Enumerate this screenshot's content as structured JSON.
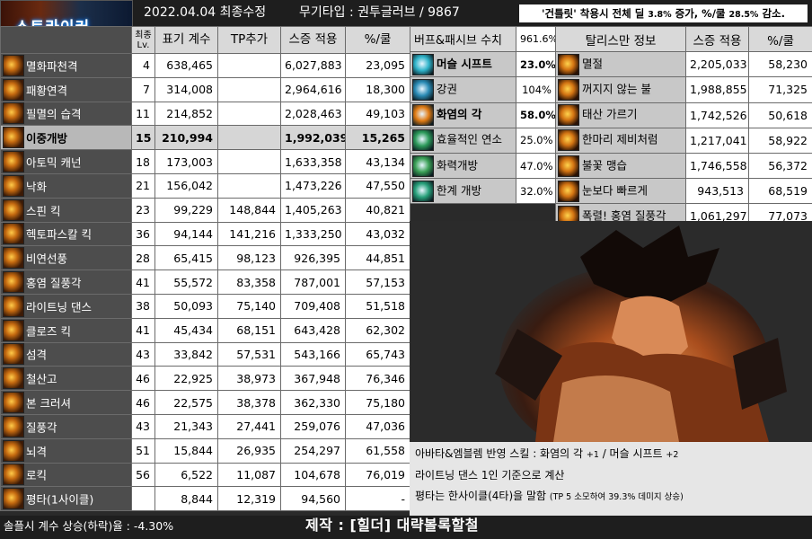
{
  "banner": {
    "logo_text": "스트라이커"
  },
  "header": {
    "date": "2022.04.04 최종수정",
    "weapon": "무기타입 : 권투글러브 / 9867"
  },
  "notice": {
    "prefix": "'건틀릿' 착용시 전체 딜 ",
    "v1": "3.8%",
    "mid": " 증가, %/쿨 ",
    "v2": "28.5%",
    "suffix": " 감소."
  },
  "skills": {
    "columns": {
      "level": "최종\nLv.",
      "coef": "표기 계수",
      "tp": "TP추가",
      "stat": "스증 적용",
      "per_cd": "%/쿨"
    },
    "rows": [
      {
        "name": "멸화파천격",
        "lv": "4",
        "coef": "638,465",
        "tp": "",
        "stat": "6,027,883",
        "per_cd": "23,095"
      },
      {
        "name": "패황연격",
        "lv": "7",
        "coef": "314,008",
        "tp": "",
        "stat": "2,964,616",
        "per_cd": "18,300"
      },
      {
        "name": "필멸의 습격",
        "lv": "11",
        "coef": "214,852",
        "tp": "",
        "stat": "2,028,463",
        "per_cd": "49,103"
      },
      {
        "name": "이중개방",
        "lv": "15",
        "coef": "210,994",
        "tp": "",
        "stat": "1,992,039",
        "per_cd": "15,265",
        "highlight": true
      },
      {
        "name": "아토믹 캐넌",
        "lv": "18",
        "coef": "173,003",
        "tp": "",
        "stat": "1,633,358",
        "per_cd": "43,134"
      },
      {
        "name": "낙화",
        "lv": "21",
        "coef": "156,042",
        "tp": "",
        "stat": "1,473,226",
        "per_cd": "47,550"
      },
      {
        "name": "스핀 킥",
        "lv": "23",
        "coef": "99,229",
        "tp": "148,844",
        "stat": "1,405,263",
        "per_cd": "40,821"
      },
      {
        "name": "헥토파스칼 킥",
        "lv": "36",
        "coef": "94,144",
        "tp": "141,216",
        "stat": "1,333,250",
        "per_cd": "43,032"
      },
      {
        "name": "비연선풍",
        "lv": "28",
        "coef": "65,415",
        "tp": "98,123",
        "stat": "926,395",
        "per_cd": "44,851"
      },
      {
        "name": "홍염 질풍각",
        "lv": "41",
        "coef": "55,572",
        "tp": "83,358",
        "stat": "787,001",
        "per_cd": "57,153"
      },
      {
        "name": "라이트닝 댄스",
        "lv": "38",
        "coef": "50,093",
        "tp": "75,140",
        "stat": "709,408",
        "per_cd": "51,518"
      },
      {
        "name": "클로즈 킥",
        "lv": "41",
        "coef": "45,434",
        "tp": "68,151",
        "stat": "643,428",
        "per_cd": "62,302"
      },
      {
        "name": "섬격",
        "lv": "43",
        "coef": "33,842",
        "tp": "57,531",
        "stat": "543,166",
        "per_cd": "65,743"
      },
      {
        "name": "철산고",
        "lv": "46",
        "coef": "22,925",
        "tp": "38,973",
        "stat": "367,948",
        "per_cd": "76,346"
      },
      {
        "name": "본 크러셔",
        "lv": "46",
        "coef": "22,575",
        "tp": "38,378",
        "stat": "362,330",
        "per_cd": "75,180"
      },
      {
        "name": "질풍각",
        "lv": "43",
        "coef": "21,343",
        "tp": "27,441",
        "stat": "259,076",
        "per_cd": "47,036"
      },
      {
        "name": "뇌격",
        "lv": "51",
        "coef": "15,844",
        "tp": "26,935",
        "stat": "254,297",
        "per_cd": "61,558"
      },
      {
        "name": "로킥",
        "lv": "56",
        "coef": "6,522",
        "tp": "11,087",
        "stat": "104,678",
        "per_cd": "76,019"
      },
      {
        "name": "평타(1사이클)",
        "lv": "",
        "coef": "8,844",
        "tp": "12,319",
        "stat": "94,560",
        "per_cd": "-"
      }
    ]
  },
  "buffs": {
    "title": "버프&패시브 수치",
    "total": "961.6%",
    "rows": [
      {
        "name": "머슬 시프트",
        "value": "23.0%",
        "bold": true,
        "color": "#2fb3c9"
      },
      {
        "name": "강권",
        "value": "104%",
        "bold": false,
        "color": "#2a8bb5"
      },
      {
        "name": "화염의 각",
        "value": "58.0%",
        "bold": true,
        "color": "#e07a12"
      },
      {
        "name": "효율적인 연소",
        "value": "25.0%",
        "bold": false,
        "color": "#2c9a5a"
      },
      {
        "name": "화력개방",
        "value": "47.0%",
        "bold": false,
        "color": "#3aa055"
      },
      {
        "name": "한계 개방",
        "value": "32.0%",
        "bold": false,
        "color": "#27a07a"
      }
    ]
  },
  "extra": {
    "columns": {
      "name": "탈리스만 정보",
      "stat": "스증 적용",
      "per_cd": "%/쿨"
    },
    "rows": [
      {
        "name": "멸절",
        "stat": "2,205,033",
        "per_cd": "58,230"
      },
      {
        "name": "꺼지지 않는 불",
        "stat": "1,988,855",
        "per_cd": "71,325"
      },
      {
        "name": "태산 가르기",
        "stat": "1,742,526",
        "per_cd": "50,618"
      },
      {
        "name": "한마리 제비처럼",
        "stat": "1,217,041",
        "per_cd": "58,922"
      },
      {
        "name": "불꽃 맹습",
        "stat": "1,746,558",
        "per_cd": "56,372"
      },
      {
        "name": "눈보다 빠르게",
        "stat": "943,513",
        "per_cd": "68,519"
      },
      {
        "name": "폭렬! 홍염 질풍각",
        "stat": "1,061,297",
        "per_cd": "77,073"
      }
    ]
  },
  "notes": {
    "line1_a": "아바타&엠블렘 반영 스킬 : 화염의 각 ",
    "line1_b": "+1",
    "line1_c": " / 머슬 시프트 ",
    "line1_d": "+2",
    "line2": "라이트닝 댄스 1인 기준으로 계산",
    "line3_a": "평타는 한사이클(4타)을 말함",
    "line3_b": "(TP 5 소모하여 39.3% 데미지 상승)"
  },
  "footer": {
    "left": "솔플시 계수 상승(하락)율 : -4.30%",
    "center": "제작 : [힐더] 대략볼록할철"
  }
}
